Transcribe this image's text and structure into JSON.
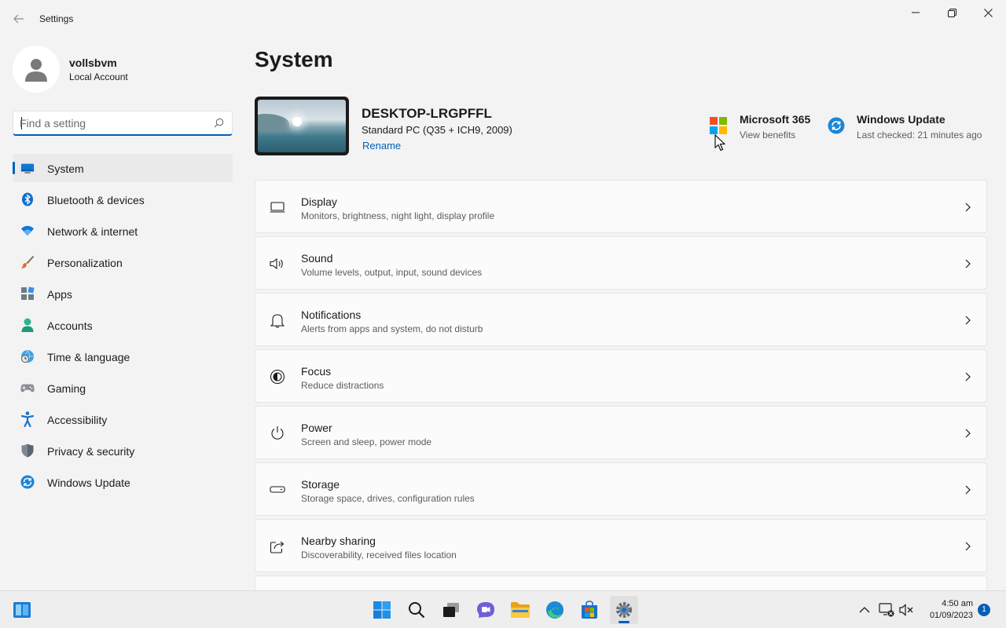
{
  "window": {
    "title": "Settings"
  },
  "profile": {
    "name": "vollsbvm",
    "account_type": "Local Account"
  },
  "search": {
    "placeholder": "Find a setting"
  },
  "sidebar": {
    "items": [
      {
        "label": "System",
        "icon": "monitor-icon",
        "active": true
      },
      {
        "label": "Bluetooth & devices",
        "icon": "bluetooth-icon"
      },
      {
        "label": "Network & internet",
        "icon": "wifi-icon"
      },
      {
        "label": "Personalization",
        "icon": "brush-icon"
      },
      {
        "label": "Apps",
        "icon": "apps-icon"
      },
      {
        "label": "Accounts",
        "icon": "person-icon"
      },
      {
        "label": "Time & language",
        "icon": "globe-clock-icon"
      },
      {
        "label": "Gaming",
        "icon": "gamepad-icon"
      },
      {
        "label": "Accessibility",
        "icon": "accessibility-icon"
      },
      {
        "label": "Privacy & security",
        "icon": "shield-icon"
      },
      {
        "label": "Windows Update",
        "icon": "update-icon"
      }
    ]
  },
  "main": {
    "title": "System",
    "device": {
      "name": "DESKTOP-LRGPFFL",
      "model": "Standard PC (Q35 + ICH9, 2009)",
      "rename_label": "Rename"
    },
    "promos": [
      {
        "title": "Microsoft 365",
        "subtitle": "View benefits",
        "icon": "microsoft-logo-icon"
      },
      {
        "title": "Windows Update",
        "subtitle": "Last checked: 21 minutes ago",
        "icon": "windows-update-icon"
      }
    ],
    "cards": [
      {
        "title": "Display",
        "subtitle": "Monitors, brightness, night light, display profile",
        "icon": "display-icon"
      },
      {
        "title": "Sound",
        "subtitle": "Volume levels, output, input, sound devices",
        "icon": "speaker-icon"
      },
      {
        "title": "Notifications",
        "subtitle": "Alerts from apps and system, do not disturb",
        "icon": "bell-icon"
      },
      {
        "title": "Focus",
        "subtitle": "Reduce distractions",
        "icon": "focus-icon"
      },
      {
        "title": "Power",
        "subtitle": "Screen and sleep, power mode",
        "icon": "power-icon"
      },
      {
        "title": "Storage",
        "subtitle": "Storage space, drives, configuration rules",
        "icon": "storage-icon"
      },
      {
        "title": "Nearby sharing",
        "subtitle": "Discoverability, received files location",
        "icon": "share-icon"
      },
      {
        "title": "",
        "subtitle": "",
        "icon": ""
      }
    ]
  },
  "taskbar": {
    "clock_time": "4:50 am",
    "clock_date": "01/09/2023",
    "notification_count": "1"
  },
  "colors": {
    "accent": "#005fb8",
    "background": "#f3f3f3",
    "card": "#fbfbfb"
  }
}
